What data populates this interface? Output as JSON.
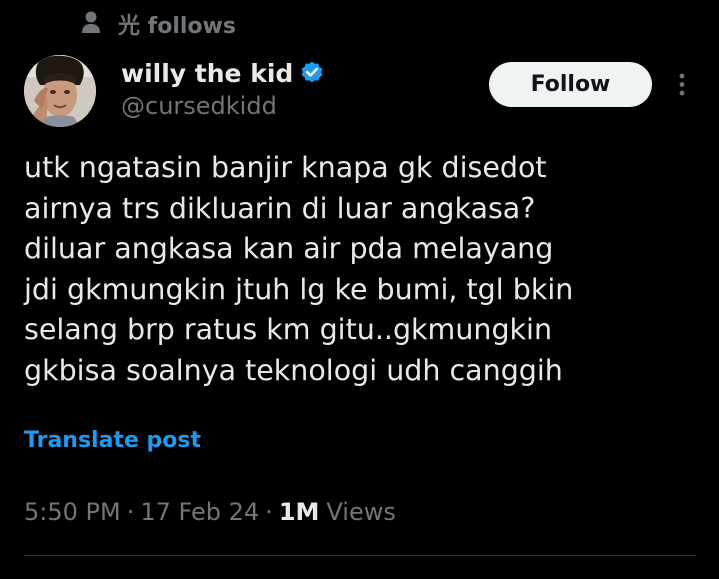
{
  "social_context": {
    "icon": "person-icon",
    "text": "光 follows"
  },
  "author": {
    "name": "willy the kid",
    "verified": true,
    "verified_icon": "verified-badge-icon",
    "handle": "@cursedkidd"
  },
  "follow_button": {
    "label": "Follow"
  },
  "more_menu": {
    "icon": "more-vertical-icon"
  },
  "post": {
    "lines": [
      "utk ngatasin banjir knapa gk disedot",
      "airnya trs dikluarin di luar angkasa?",
      "diluar angkasa kan air pda melayang",
      "jdi gkmungkin jtuh lg ke bumi, tgl bkin",
      "selang brp ratus km gitu..gkmungkin",
      "gkbisa soalnya teknologi udh canggih"
    ],
    "translate_label": "Translate post"
  },
  "meta": {
    "time": "5:50 PM",
    "separator": "·",
    "date": "17 Feb 24",
    "views_count": "1M",
    "views_label": "Views"
  },
  "colors": {
    "background": "#000000",
    "text_primary": "#e7e9ea",
    "text_secondary": "#71767b",
    "accent": "#1d9bf0",
    "follow_bg": "#eff3f4",
    "divider": "#2f3336"
  }
}
